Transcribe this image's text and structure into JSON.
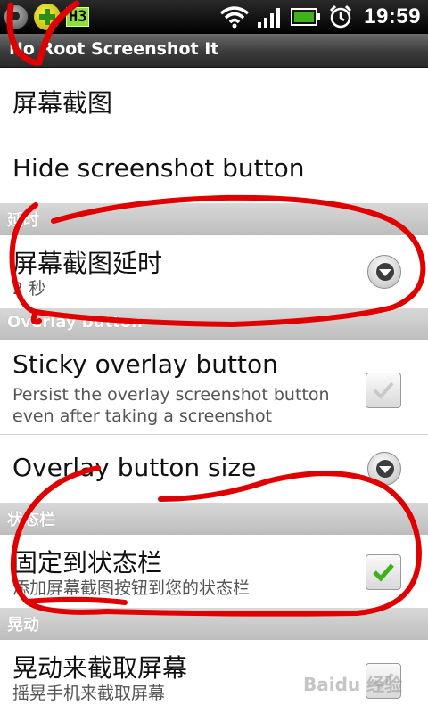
{
  "status_bar": {
    "time": "19:59",
    "left_icons": [
      "usb-icon",
      "plus-icon",
      "h3-network-icon"
    ],
    "h3_label": "H3",
    "right_icons": [
      "wifi-icon",
      "signal-icon",
      "battery-icon",
      "alarm-icon"
    ]
  },
  "app": {
    "title": "No Root Screenshot It"
  },
  "list": {
    "item_screenshot": {
      "title": "屏幕截图"
    },
    "item_hide_button": {
      "title": "Hide screenshot button"
    },
    "header_delay": "延时",
    "item_delay": {
      "title": "屏幕截图延时",
      "summary": "2 秒"
    },
    "header_overlay": "Overlay button",
    "item_sticky": {
      "title": "Sticky overlay button",
      "summary_line1": "Persist the overlay screenshot button",
      "summary_line2": "even after taking a screenshot",
      "checked": false
    },
    "item_overlay_size": {
      "title": "Overlay button size"
    },
    "header_statusbar": "状态栏",
    "item_pin": {
      "title": "固定到状态栏",
      "summary": "添加屏幕截图按钮到您的状态栏",
      "checked": true
    },
    "header_shake": "晃动",
    "item_shake": {
      "title": "晃动来截取屏幕",
      "summary": "摇晃手机来截取屏幕",
      "checked": false
    }
  },
  "watermark": "Baidu 经验",
  "colors": {
    "status_bar": "#000000",
    "title_bar": "#3a3a3a",
    "section_header": "#c6c6c6",
    "check_green": "#3fb11a",
    "annotation_red": "#e00000"
  }
}
